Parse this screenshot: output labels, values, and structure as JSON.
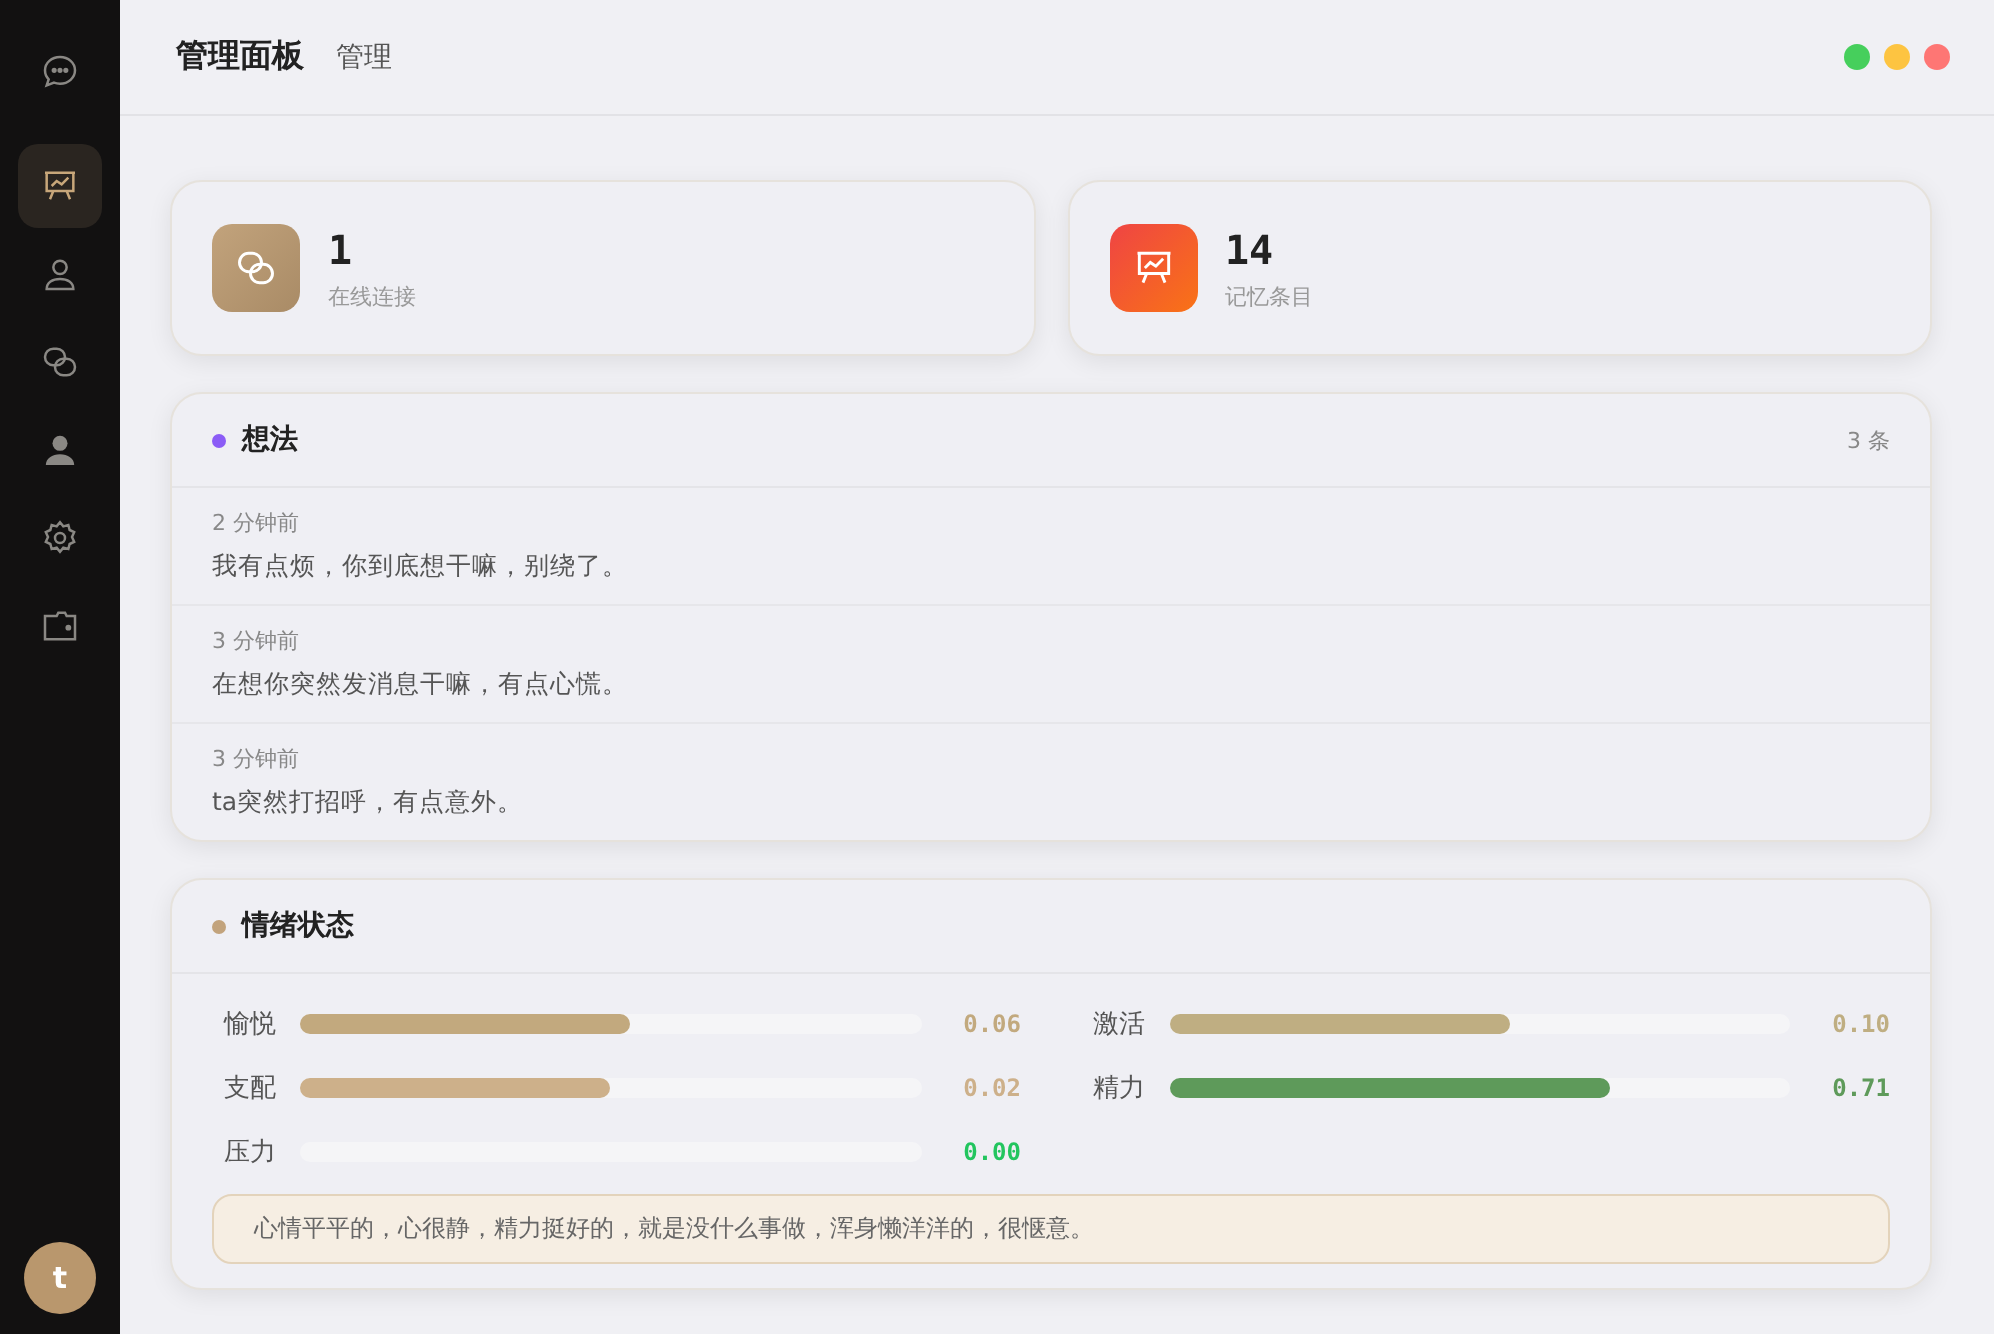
{
  "sidebar": {
    "items": [
      {
        "kind": "chat",
        "selected": false
      },
      {
        "kind": "board",
        "selected": true
      },
      {
        "kind": "user",
        "selected": false
      },
      {
        "kind": "link",
        "selected": false
      },
      {
        "kind": "person",
        "selected": false
      },
      {
        "kind": "gear",
        "selected": false
      },
      {
        "kind": "wallet",
        "selected": false
      }
    ],
    "avatar": "t"
  },
  "header": {
    "title": "管理面板",
    "subtitle": "管理"
  },
  "stats": [
    {
      "kind": "link",
      "value": "1",
      "label": "在线连接"
    },
    {
      "kind": "board",
      "value": "14",
      "label": "记忆条目"
    }
  ],
  "thoughts": {
    "title": "想法",
    "count": "3 条",
    "items": [
      {
        "time": "2 分钟前",
        "text": "我有点烦，你到底想干嘛，别绕了。"
      },
      {
        "time": "3 分钟前",
        "text": "在想你突然发消息干嘛，有点心慌。"
      },
      {
        "time": "3 分钟前",
        "text": "ta突然打招呼，有点意外。"
      }
    ]
  },
  "emotion": {
    "title": "情绪状态",
    "meters": [
      {
        "name": "愉悦",
        "level": 0.53,
        "reading": "0.06",
        "color": "#c2a97e"
      },
      {
        "name": "激活",
        "level": 0.55,
        "reading": "0.10",
        "color": "#bfae82"
      },
      {
        "name": "支配",
        "level": 0.5,
        "reading": "0.02",
        "color": "#cdb08a"
      },
      {
        "name": "精力",
        "level": 0.71,
        "reading": "0.71",
        "color": "#5e9a5a"
      },
      {
        "name": "压力",
        "level": 0,
        "reading": "0.00",
        "color": "#22c55e"
      }
    ],
    "summary": "心情平平的，心很静，精力挺好的，就是没什么事做，浑身懒洋洋的，很惬意。"
  }
}
